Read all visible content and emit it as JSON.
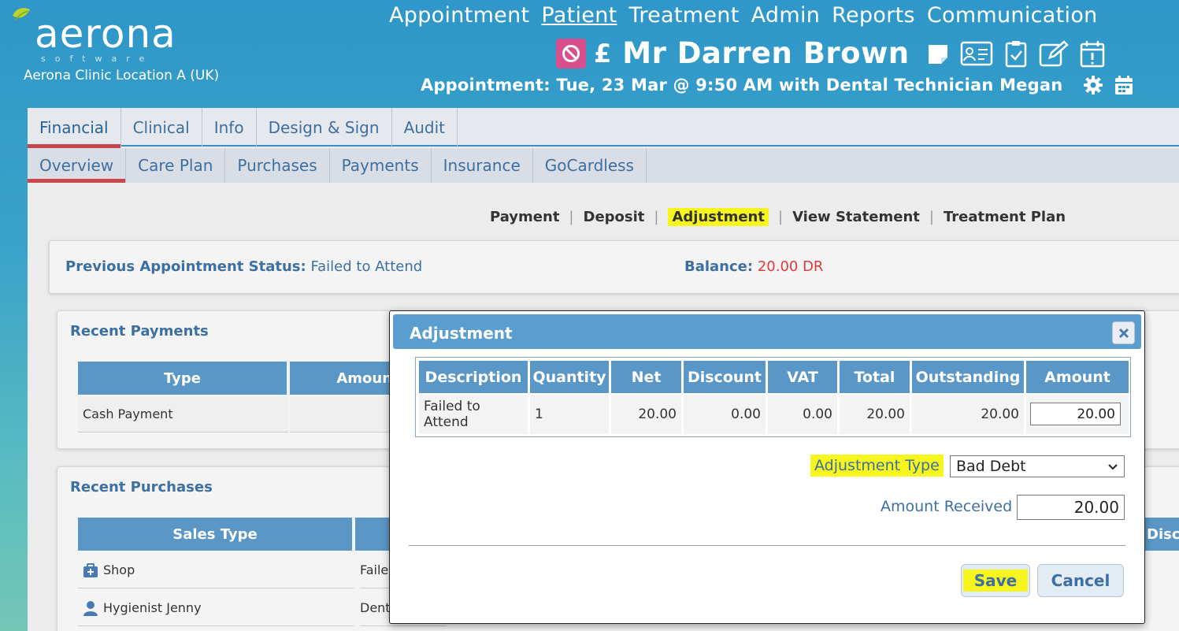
{
  "brand": {
    "logo_text": "aerona",
    "logo_sub": "software",
    "clinic": "Aerona Clinic Location A (UK)"
  },
  "topnav": [
    {
      "label": "Appointment",
      "active": false
    },
    {
      "label": "Patient",
      "active": true
    },
    {
      "label": "Treatment",
      "active": false
    },
    {
      "label": "Admin",
      "active": false
    },
    {
      "label": "Reports",
      "active": false
    },
    {
      "label": "Communication",
      "active": false
    }
  ],
  "patient": {
    "currency_symbol": "£",
    "name": "Mr Darren Brown",
    "icons": [
      "no-entry-icon",
      "sticky-note-icon",
      "id-card-icon",
      "clipboard-check-icon",
      "edit-icon",
      "calendar-alert-icon"
    ]
  },
  "appointment": {
    "text": "Appointment: Tue, 23 Mar @ 9:50 AM  with Dental Technician Megan",
    "icons": [
      "gear-icon",
      "calendar-icon"
    ]
  },
  "tabs_primary": [
    "Financial",
    "Clinical",
    "Info",
    "Design & Sign",
    "Audit"
  ],
  "tabs_secondary": [
    "Overview",
    "Care Plan",
    "Purchases",
    "Payments",
    "Insurance",
    "GoCardless"
  ],
  "actions": [
    "Payment",
    "Deposit",
    "Adjustment",
    "View Statement",
    "Treatment Plan"
  ],
  "status": {
    "prev_label": "Previous Appointment Status:",
    "prev_value": "Failed to Attend",
    "balance_label": "Balance:",
    "balance_value": "20.00 DR"
  },
  "recent_payments": {
    "title": "Recent Payments",
    "headers": [
      "Type",
      "Amount"
    ],
    "rows": [
      [
        "Cash Payment",
        ""
      ]
    ]
  },
  "recent_purchases": {
    "title": "Recent Purchases",
    "headers": [
      "Sales Type",
      ""
    ],
    "right_header_partial": "Disco",
    "rows": [
      {
        "type": "Shop",
        "icon": "medkit-icon",
        "desc": "Faile"
      },
      {
        "type": "Hygienist Jenny",
        "icon": "person-icon",
        "desc": "Dent"
      }
    ]
  },
  "modal": {
    "title": "Adjustment",
    "headers": [
      "Description",
      "Quantity",
      "Net",
      "Discount",
      "VAT",
      "Total",
      "Outstanding",
      "Amount"
    ],
    "row": {
      "description": "Failed to Attend",
      "quantity": "1",
      "net": "20.00",
      "discount": "0.00",
      "vat": "0.00",
      "total": "20.00",
      "outstanding": "20.00",
      "amount": "20.00"
    },
    "adjustment_type_label": "Adjustment Type",
    "adjustment_type_value": "Bad Debt",
    "amount_received_label": "Amount Received",
    "amount_received_value": "20.00",
    "save_label": "Save",
    "cancel_label": "Cancel"
  },
  "colors": {
    "accent": "#5a97c6",
    "highlight": "#f6f51e",
    "tab_underline": "#c9474a",
    "balance_red": "#e03a3a"
  }
}
